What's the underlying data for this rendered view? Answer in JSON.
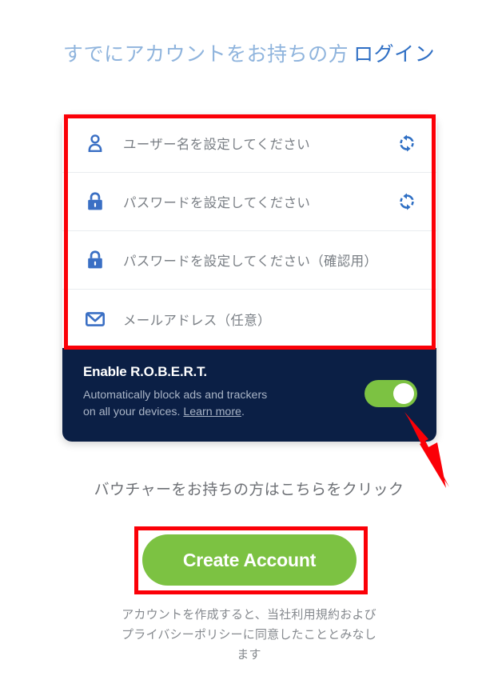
{
  "header": {
    "prefix": "すでにアカウントをお持ちの方",
    "link": "ログイン"
  },
  "form": {
    "fields": [
      {
        "icon": "user-icon",
        "placeholder": "ユーザー名を設定してください",
        "action_icon": "refresh-icon",
        "has_action": true
      },
      {
        "icon": "lock-icon",
        "placeholder": "パスワードを設定してください",
        "action_icon": "refresh-icon",
        "has_action": true
      },
      {
        "icon": "lock-icon",
        "placeholder": "パスワードを設定してください（確認用）",
        "action_icon": "",
        "has_action": false
      },
      {
        "icon": "envelope-icon",
        "placeholder": "メールアドレス（任意）",
        "action_icon": "",
        "has_action": false
      }
    ]
  },
  "robert": {
    "title": "Enable R.O.B.E.R.T.",
    "description_line1": "Automatically block ads and trackers",
    "description_line2": "on all your devices. ",
    "learn_more": "Learn more",
    "description_end": ".",
    "toggle_state": "on"
  },
  "voucher": {
    "text": "バウチャーをお持ちの方はこちらをクリック"
  },
  "cta": {
    "label": "Create Account"
  },
  "terms": {
    "line1": "アカウントを作成すると、当社利用規約および",
    "line2": "プライバシーポリシーに同意したこととみなし",
    "line3": "ます"
  },
  "colors": {
    "accent_blue": "#2f6fc4",
    "header_light_blue": "#8fb4dd",
    "panel_navy": "#0b1f45",
    "toggle_green": "#7cc242",
    "button_green": "#7cc242",
    "annotation_red": "#fb0007",
    "label_gray": "#7a7f85"
  }
}
